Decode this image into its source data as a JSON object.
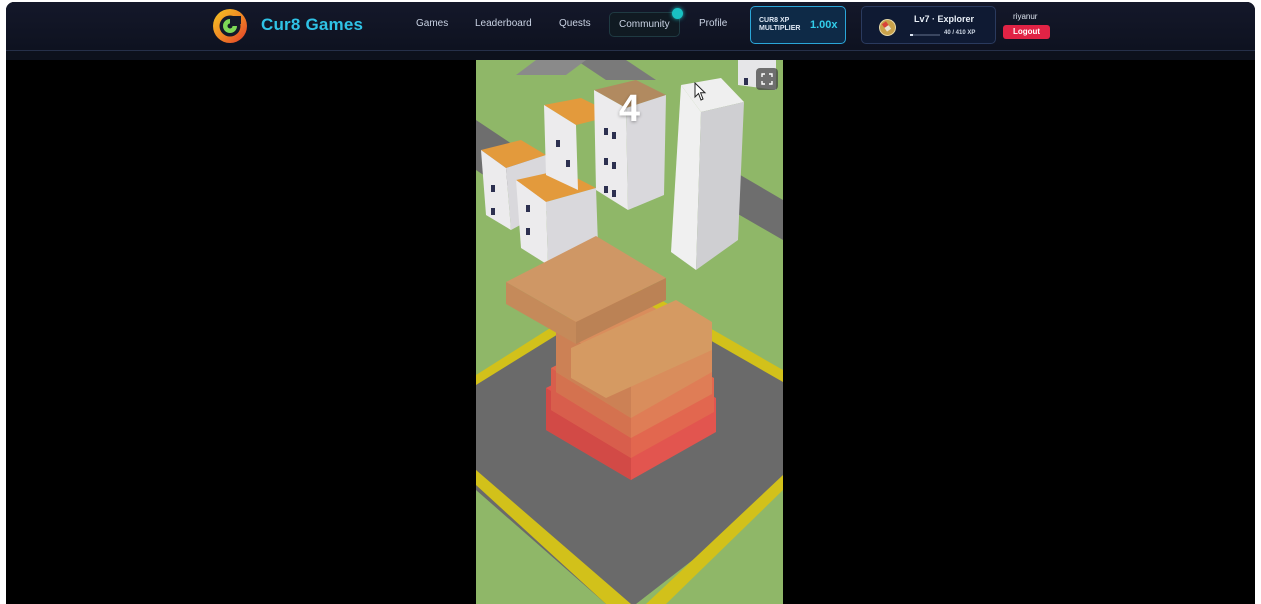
{
  "header": {
    "brand": "Cur8 Games",
    "nav": [
      {
        "label": "Games"
      },
      {
        "label": "Leaderboard"
      },
      {
        "label": "Quests"
      },
      {
        "label": "Community",
        "active": true,
        "notification": true
      },
      {
        "label": "Profile"
      }
    ],
    "xp_multiplier": {
      "label_line1": "CUR8 XP",
      "label_line2": "MULTIPLIER",
      "value": "1.00x"
    },
    "level": {
      "text": "Lv7  · Explorer",
      "xp": "40 / 410 XP",
      "progress": 0.0976
    },
    "user": {
      "name": "riyanur",
      "logout_label": "Logout"
    }
  },
  "game": {
    "score": "4",
    "fullscreen_icon": "fullscreen-icon"
  },
  "colors": {
    "accent": "#2fc3e6",
    "logout": "#e02345",
    "notification": "#19c1c3"
  }
}
